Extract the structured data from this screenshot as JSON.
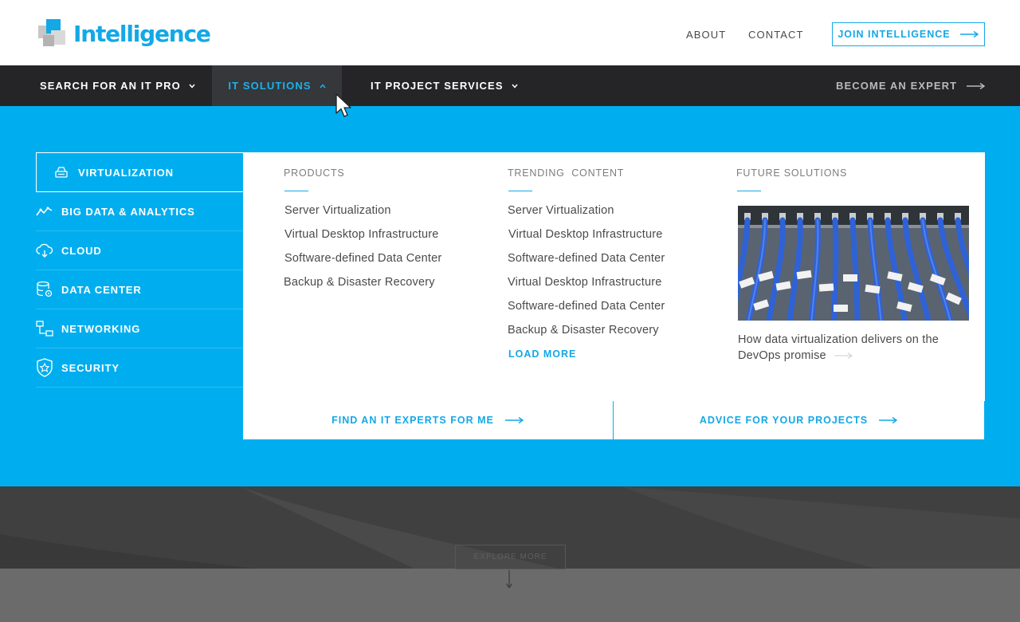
{
  "brand": {
    "name": "Intelligence",
    "color": "#13a8e6"
  },
  "header": {
    "links": [
      {
        "label": "ABOUT"
      },
      {
        "label": "CONTACT"
      }
    ],
    "join_label": "JOIN INTELLIGENCE",
    "join_icon": "arrow-right-icon"
  },
  "nav": {
    "items": [
      {
        "label": "SEARCH FOR AN IT PRO",
        "icon": "chevron-down-icon"
      },
      {
        "label": "IT SOLUTIONS",
        "icon": "chevron-up-icon",
        "active": true
      },
      {
        "label": "IT PROJECT SERVICES",
        "icon": "chevron-down-icon"
      }
    ],
    "become_label": "BECOME AN EXPERT",
    "become_icon": "arrow-right-icon"
  },
  "categories": [
    {
      "label": "VIRTUALIZATION",
      "icon": "virtualization-icon",
      "selected": true
    },
    {
      "label": "BIG DATA & ANALYTICS",
      "icon": "line-chart-icon"
    },
    {
      "label": "CLOUD",
      "icon": "cloud-icon"
    },
    {
      "label": "DATA CENTER",
      "icon": "database-gear-icon"
    },
    {
      "label": "NETWORKING",
      "icon": "network-icon"
    },
    {
      "label": "SECURITY",
      "icon": "shield-star-icon"
    }
  ],
  "columns": {
    "products": {
      "heading": "PRODUCTS",
      "links": [
        "Server Virtualization",
        "Virtual Desktop Infrastructure",
        "Software-defined Data Center",
        "Backup & Disaster Recovery"
      ]
    },
    "trending": {
      "heading": "TRENDING  CONTENT",
      "links": [
        "Server Virtualization",
        "Virtual Desktop Infrastructure",
        "Software-defined Data Center",
        "Virtual Desktop Infrastructure",
        "Software-defined Data Center",
        "Backup & Disaster Recovery"
      ],
      "load_more": "LOAD MORE"
    },
    "future": {
      "heading": "FUTURE SOLUTIONS",
      "image": "network-cables-photo",
      "caption": "How data virtualization delivers on the DevOps promise"
    }
  },
  "ctas": [
    {
      "label": "FIND AN IT EXPERTS FOR ME",
      "icon": "arrow-right-icon"
    },
    {
      "label": "ADVICE FOR YOUR PROJECTS",
      "icon": "arrow-right-icon"
    }
  ],
  "hero": {
    "explore_label": "EXPLORE MORE",
    "explore_icon": "arrow-down-icon"
  },
  "colors": {
    "accent": "#00aeef",
    "nav_bg": "#252527",
    "text": "#4a4a4a"
  }
}
